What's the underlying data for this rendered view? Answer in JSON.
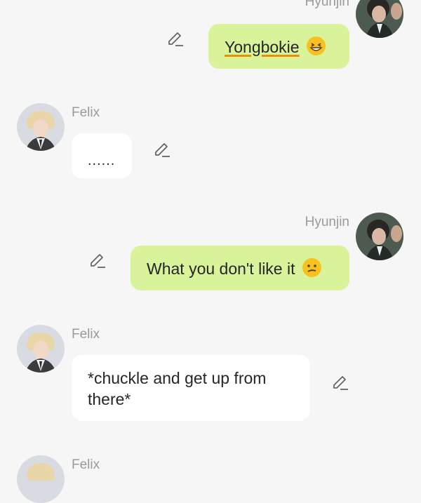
{
  "messages": [
    {
      "sender": "Hyunjin",
      "side": "right",
      "text": "Yongbokie",
      "emoji": "grinning-squint-face"
    },
    {
      "sender": "Felix",
      "side": "left",
      "text": "......"
    },
    {
      "sender": "Hyunjin",
      "side": "right",
      "text": "What you don't like it",
      "emoji": "confused-face"
    },
    {
      "sender": "Felix",
      "side": "left",
      "text": "*chuckle and get up from there*"
    },
    {
      "sender": "Felix",
      "side": "left",
      "text": ""
    }
  ],
  "colors": {
    "background": "#f6f6f6",
    "my_bubble": "#d9f39a",
    "their_bubble": "#ffffff",
    "name_text": "#9a9a9a",
    "underline": "#f08c00",
    "emoji": "#f7c21f"
  },
  "icons": {
    "edit": "pencil-edit-icon"
  }
}
